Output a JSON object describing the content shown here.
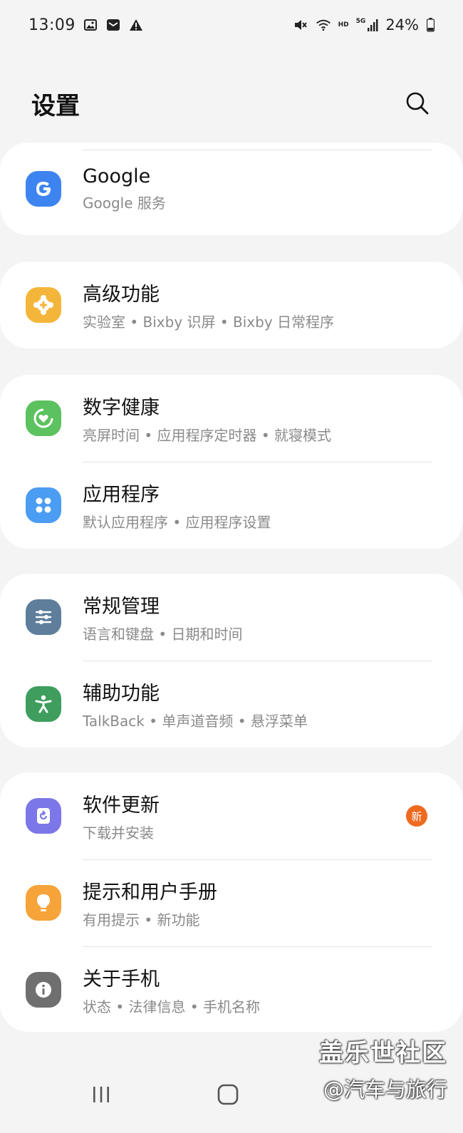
{
  "status_bar": {
    "time": "13:09",
    "network": "5G",
    "hd": "HD",
    "battery": "24%",
    "icons_left": [
      "gallery-icon",
      "mail-icon",
      "warning-icon"
    ],
    "icons_right": [
      "mute-icon",
      "wifi-icon",
      "signal-icon",
      "battery-icon"
    ]
  },
  "header": {
    "title": "设置"
  },
  "sections": [
    {
      "items": [
        {
          "title": "Google",
          "subtitle": "Google 服务",
          "icon": "google-icon",
          "color": "#3e84f0"
        }
      ]
    },
    {
      "items": [
        {
          "title": "高级功能",
          "subtitle": "实验室 • Bixby 识屏 • Bixby 日常程序",
          "icon": "puzzle-plus-icon",
          "color": "#f4b63a"
        }
      ]
    },
    {
      "items": [
        {
          "title": "数字健康",
          "subtitle": "亮屏时间 • 应用程序定时器 • 就寝模式",
          "icon": "heart-ring-icon",
          "color": "#5cc25f"
        },
        {
          "title": "应用程序",
          "subtitle": "默认应用程序 • 应用程序设置",
          "icon": "apps-grid-icon",
          "color": "#4b9cf3"
        }
      ]
    },
    {
      "items": [
        {
          "title": "常规管理",
          "subtitle": "语言和键盘 • 日期和时间",
          "icon": "sliders-icon",
          "color": "#5e7e9b"
        },
        {
          "title": "辅助功能",
          "subtitle": "TalkBack • 单声道音频 • 悬浮菜单",
          "icon": "accessibility-icon",
          "color": "#3f9e5e"
        }
      ]
    },
    {
      "items": [
        {
          "title": "软件更新",
          "subtitle": "下载并安装",
          "icon": "update-icon",
          "color": "#7b77e8",
          "badge": "新"
        },
        {
          "title": "提示和用户手册",
          "subtitle": "有用提示 • 新功能",
          "icon": "lightbulb-icon",
          "color": "#f6a43a"
        },
        {
          "title": "关于手机",
          "subtitle": "状态 • 法律信息 • 手机名称",
          "icon": "info-icon",
          "color": "#6f6f6f"
        }
      ]
    }
  ],
  "watermark": {
    "line1": "盖乐世社区",
    "line2": "@汽车与旅行"
  },
  "colors": {
    "background": "#f4f4f4",
    "card": "#ffffff",
    "badge": "#ee6a1f"
  }
}
